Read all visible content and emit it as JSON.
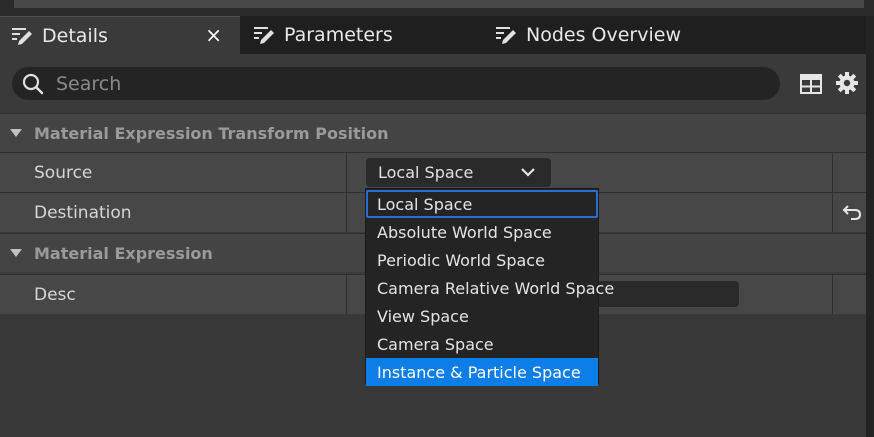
{
  "tabs": [
    {
      "label": "Details",
      "icon": "edit-pencil-icon",
      "active": true,
      "close": "×"
    },
    {
      "label": "Parameters",
      "icon": "edit-pencil-icon",
      "active": false
    },
    {
      "label": "Nodes Overview",
      "icon": "edit-pencil-icon",
      "active": false
    }
  ],
  "search": {
    "placeholder": "Search",
    "value": ""
  },
  "toolbar": {
    "icons": [
      "table-view-icon",
      "settings-gear-icon"
    ]
  },
  "categories": [
    {
      "label": "Material Expression Transform Position"
    },
    {
      "label": "Material Expression"
    }
  ],
  "properties": {
    "source": {
      "label": "Source",
      "value": "Local Space"
    },
    "destination": {
      "label": "Destination"
    },
    "desc": {
      "label": "Desc",
      "value": ""
    }
  },
  "dropdown": {
    "options": [
      "Local Space",
      "Absolute World Space",
      "Periodic World Space",
      "Camera Relative World Space",
      "View Space",
      "Camera Space",
      "Instance & Particle Space"
    ],
    "current": "Local Space",
    "hovered": "Instance & Particle Space"
  },
  "colors": {
    "accent": "#0d7ee8",
    "focus_border": "#2a6fd0",
    "background": "#3b3b3b"
  }
}
